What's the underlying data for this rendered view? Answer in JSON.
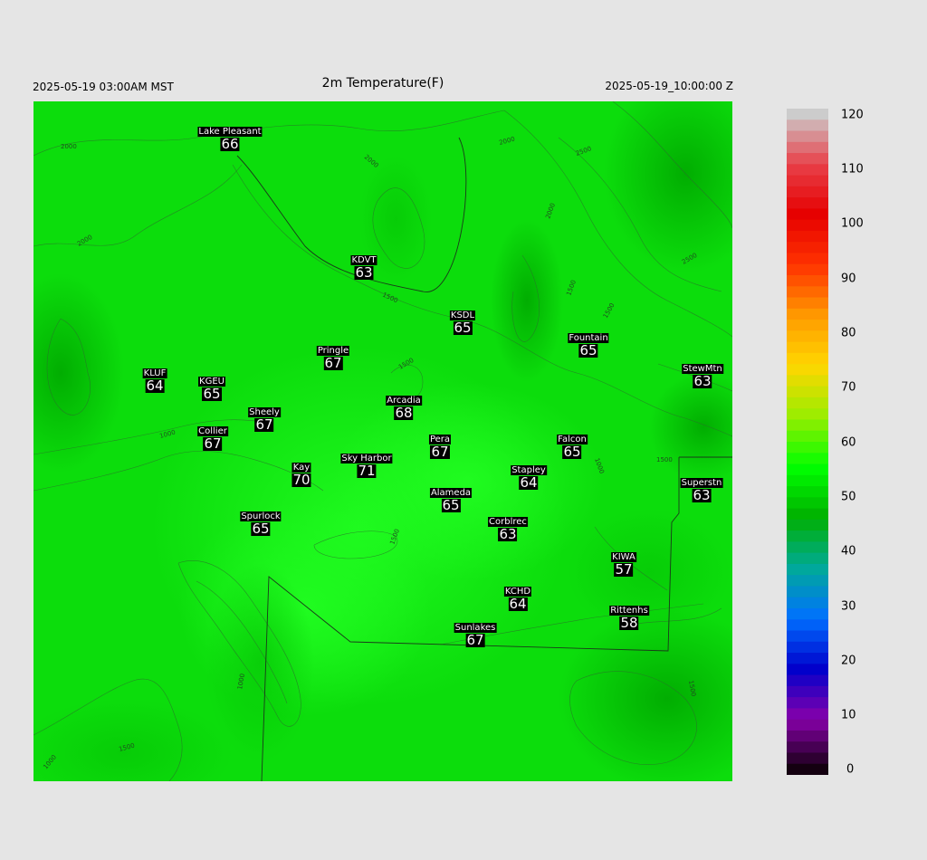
{
  "header": {
    "local_time": "2025-05-19 03:00AM MST",
    "title": "2m Temperature(F)",
    "utc_time": "2025-05-19_10:00:00 Z"
  },
  "colorbar": {
    "ticks": [
      "120",
      "110",
      "100",
      "90",
      "80",
      "70",
      "60",
      "50",
      "40",
      "30",
      "20",
      "10",
      "0"
    ],
    "colors": [
      "#cccccc",
      "#e84048",
      "#e60000",
      "#ff3300",
      "#ff9a00",
      "#ffd700",
      "#9aed00",
      "#00ff00",
      "#00b000",
      "#00aa99",
      "#0070ff",
      "#0000cc",
      "#8800aa",
      "#140010"
    ]
  },
  "map": {
    "contour_labels": [
      "2000",
      "2000",
      "2000",
      "2500",
      "2000",
      "1500",
      "2500",
      "2000",
      "1500",
      "1500",
      "1500",
      "1000",
      "1000",
      "1500",
      "1500",
      "1000",
      "1500",
      "1000",
      "1500"
    ]
  },
  "stations": [
    {
      "name": "Lake Pleasant",
      "value": "66"
    },
    {
      "name": "KDVT",
      "value": "63"
    },
    {
      "name": "KSDL",
      "value": "65"
    },
    {
      "name": "Fountain",
      "value": "65"
    },
    {
      "name": "Pringle",
      "value": "67"
    },
    {
      "name": "KLUF",
      "value": "64"
    },
    {
      "name": "KGEU",
      "value": "65"
    },
    {
      "name": "StewMtn",
      "value": "63"
    },
    {
      "name": "Arcadia",
      "value": "68"
    },
    {
      "name": "Sheely",
      "value": "67"
    },
    {
      "name": "Collier",
      "value": "67"
    },
    {
      "name": "Pera",
      "value": "67"
    },
    {
      "name": "Falcon",
      "value": "65"
    },
    {
      "name": "Kay",
      "value": "70"
    },
    {
      "name": "Sky Harbor",
      "value": "71"
    },
    {
      "name": "Stapley",
      "value": "64"
    },
    {
      "name": "Superstn",
      "value": "63"
    },
    {
      "name": "Alameda",
      "value": "65"
    },
    {
      "name": "Spurlock",
      "value": "65"
    },
    {
      "name": "Corblrec",
      "value": "63"
    },
    {
      "name": "KIWA",
      "value": "57"
    },
    {
      "name": "KCHD",
      "value": "64"
    },
    {
      "name": "Rittenhs",
      "value": "58"
    },
    {
      "name": "Sunlakes",
      "value": "67"
    }
  ]
}
